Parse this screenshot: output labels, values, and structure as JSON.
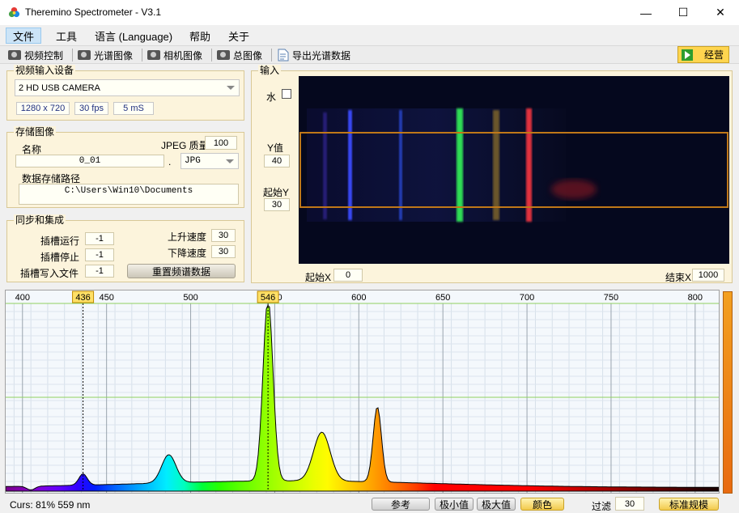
{
  "window": {
    "title": "Theremino Spectrometer - V3.1",
    "minimize": "—",
    "maximize": "☐",
    "close": "✕"
  },
  "menu": [
    "文件",
    "工具",
    "语言 (Language)",
    "帮助",
    "关于"
  ],
  "toolbar": {
    "video_control": "视频控制",
    "spectrum_image": "光谱图像",
    "camera_image": "相机图像",
    "total_image": "总图像",
    "export_spectrum": "导出光谱数据",
    "run": "经营"
  },
  "video_input": {
    "title": "视频输入设备",
    "device": "2 HD USB CAMERA",
    "resolution": "1280 x 720",
    "fps": "30 fps",
    "exposure": "5 mS"
  },
  "store_image": {
    "title": "存储图像",
    "name_label": "名称",
    "jpeg_quality_label": "JPEG 质量",
    "jpeg_quality": "100",
    "filename": "0_01",
    "dot": ".",
    "format": "JPG",
    "path_label": "数据存储路径",
    "path": "C:\\Users\\Win10\\Documents"
  },
  "sync": {
    "title": "同步和集成",
    "slot_run_label": "插槽运行",
    "slot_run": "-1",
    "slot_stop_label": "插槽停止",
    "slot_stop": "-1",
    "slot_write_label": "插槽写入文件",
    "slot_write": "-1",
    "rise_label": "上升速度",
    "rise": "30",
    "fall_label": "下降速度",
    "fall": "30",
    "reset_button": "重置频谱数据"
  },
  "input": {
    "title": "输入",
    "water_label": "水",
    "water_checked": false,
    "y_label": "Y值",
    "y_value": "40",
    "start_y_label": "起始Y",
    "start_y": "30",
    "start_x_label": "起始X",
    "start_x": "0",
    "end_x_label": "结束X",
    "end_x": "1000"
  },
  "spectrum": {
    "axis_ticks": [
      "400",
      "450",
      "500",
      "550",
      "600",
      "650",
      "700",
      "750",
      "800"
    ],
    "markers": [
      "436",
      "546"
    ],
    "nm_range": [
      390,
      815
    ],
    "peaks_nm": [
      {
        "nm": 405,
        "intensity": 0.02
      },
      {
        "nm": 436,
        "intensity": 0.1
      },
      {
        "nm": 487,
        "intensity": 0.19
      },
      {
        "nm": 546,
        "intensity": 0.97
      },
      {
        "nm": 578,
        "intensity": 0.3
      },
      {
        "nm": 611,
        "intensity": 0.44
      }
    ]
  },
  "status": {
    "cursor": "Curs: 81%   559 nm",
    "reference": "参考",
    "min": "极小值",
    "max": "极大值",
    "color": "颜色",
    "filter_label": "过滤",
    "filter": "30",
    "calibrate": "标准规模"
  },
  "colors": {
    "panel_bg": "#fcf4dc",
    "marker_yellow": "#ffd54f",
    "roi_orange": "#c07818",
    "camera_bg": "#05081e"
  }
}
